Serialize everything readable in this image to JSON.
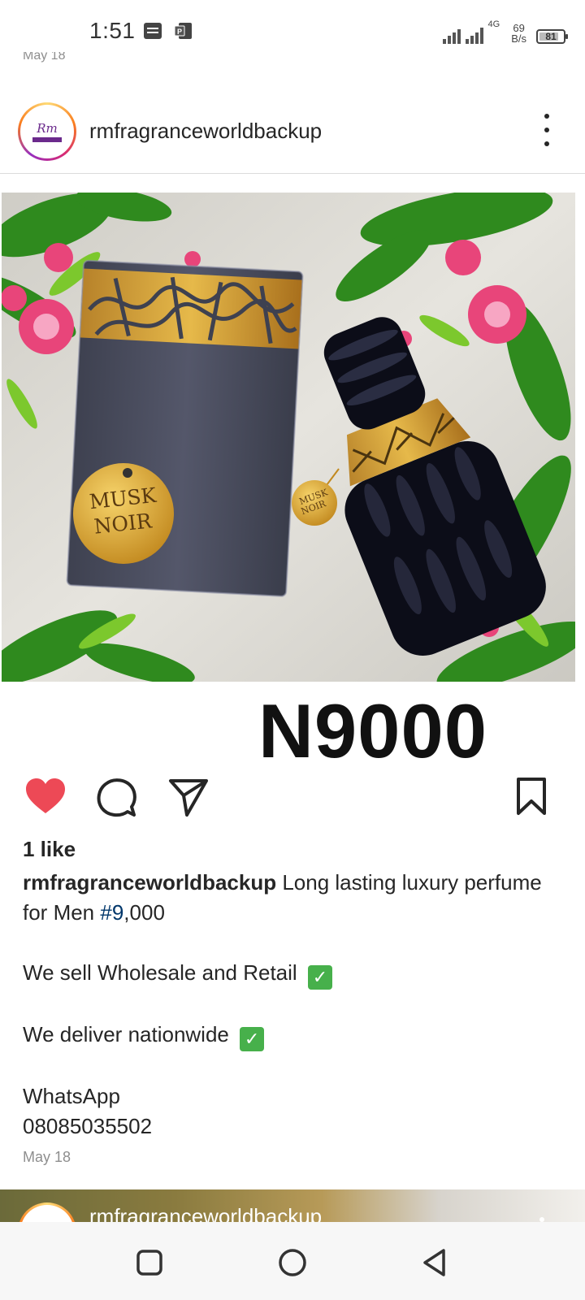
{
  "status_bar": {
    "time": "1:51",
    "network": "4G",
    "speed_value": "69",
    "speed_unit": "B/s",
    "battery": "81",
    "battery_level": 0.81
  },
  "previous_post": {
    "date": "May 18"
  },
  "post": {
    "username": "rmfragranceworldbackup",
    "avatar_text": "Rm",
    "image_labels": {
      "line1": "MUSK",
      "line2": "NOIR"
    },
    "price": "N9000",
    "likes": "1 like",
    "caption": {
      "username": "rmfragranceworldbackup",
      "text_start": " Long lasting luxury perfume for Men  ",
      "hashtag": "#9",
      "text_after_hashtag": ",000",
      "line2": "We sell Wholesale and Retail",
      "line3": "We deliver nationwide",
      "line4": "WhatsApp",
      "line5": "08085035502",
      "check": "✓"
    },
    "date": "May 18"
  },
  "next_post": {
    "username": "rmfragranceworldbackup"
  },
  "colors": {
    "like_red": "#ed4956",
    "hashtag_blue": "#00376b",
    "check_green": "#47b04b"
  }
}
